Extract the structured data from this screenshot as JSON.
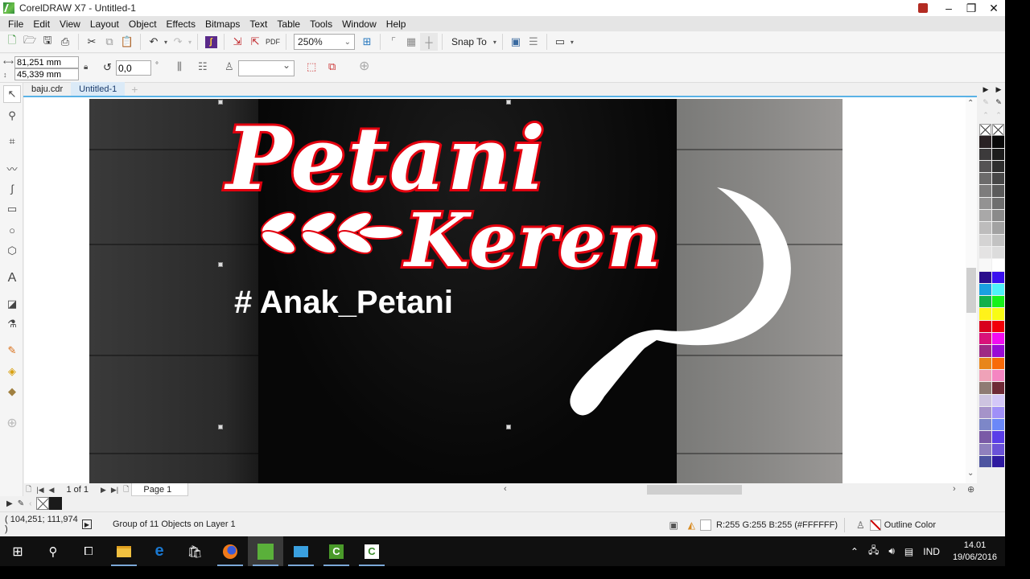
{
  "window": {
    "title": "CorelDRAW X7 - Untitled-1",
    "controls": [
      "minimize",
      "restore",
      "close"
    ]
  },
  "menu": {
    "items": [
      {
        "label": "File"
      },
      {
        "label": "Edit"
      },
      {
        "label": "View"
      },
      {
        "label": "Layout"
      },
      {
        "label": "Object"
      },
      {
        "label": "Effects"
      },
      {
        "label": "Bitmaps"
      },
      {
        "label": "Text"
      },
      {
        "label": "Table"
      },
      {
        "label": "Tools"
      },
      {
        "label": "Window"
      },
      {
        "label": "Help"
      }
    ]
  },
  "toolbar": {
    "zoom_level": "250%",
    "snap_to_label": "Snap To"
  },
  "propbar": {
    "width_value": "81,251 mm",
    "height_value": "45,339 mm",
    "rotation_value": "0,0",
    "degree_symbol": "°",
    "outline_width_value": ""
  },
  "doc_tabs": [
    {
      "label": "baju.cdr",
      "active": false
    },
    {
      "label": "Untitled-1",
      "active": true
    }
  ],
  "canvas": {
    "design_title_line1": "Petani",
    "design_title_line2": "Keren",
    "design_hashtag": "# Anak_Petani",
    "title_fill": "#ffffff",
    "title_outline": "#e3000f"
  },
  "page_nav": {
    "page_count": "1 of 1",
    "page_tab_label": "Page 1"
  },
  "palette": {
    "col1": [
      "#2a2224",
      "#3c3a3b",
      "#555354",
      "#6c6b6b",
      "#7d7c7c",
      "#939292",
      "#a9a8a8",
      "#bdbcbc",
      "#d4d3d3",
      "#e4e3e3",
      "#f8f8f8",
      "#2a0e8c",
      "#1aa0e0",
      "#12b04a",
      "#fff21a",
      "#d8001c",
      "#d8127a",
      "#9e2a84",
      "#e8861a",
      "#efa2b8",
      "#8e7b73",
      "#cdc4e0",
      "#a593c9",
      "#7d87c8",
      "#7a5aa6",
      "#8f80bd",
      "#4d54a0"
    ],
    "col2": [
      "#080808",
      "#1c1c1c",
      "#2e2e2e",
      "#474747",
      "#5b5b5b",
      "#6e6e6e",
      "#8a8a8a",
      "#a2a2a2",
      "#c2c2c2",
      "#dcdcdc",
      "#ffffff",
      "#3a10f0",
      "#4ef2fa",
      "#16f21a",
      "#f8fc14",
      "#f20008",
      "#f20cf0",
      "#9a0ad6",
      "#f86a08",
      "#f586c2",
      "#6e2a36",
      "#d4c8f8",
      "#a090f8",
      "#6a88f8",
      "#5a3ee8",
      "#6a52d8",
      "#2e1aa0"
    ]
  },
  "status": {
    "coordinates": "( 104,251; 111,974 )",
    "selection_info": "Group of 11 Objects on Layer 1",
    "fill_info": "R:255 G:255 B:255 (#FFFFFF)",
    "outline_info": "Outline Color"
  },
  "taskbar": {
    "apps": [
      {
        "name": "file-explorer",
        "open": true
      },
      {
        "name": "edge",
        "open": false
      },
      {
        "name": "store",
        "open": false
      },
      {
        "name": "firefox",
        "open": true
      },
      {
        "name": "coreldraw",
        "open": true,
        "active": true
      },
      {
        "name": "app-blue",
        "open": true
      },
      {
        "name": "camtasia-recorder",
        "open": true
      },
      {
        "name": "camtasia-studio",
        "open": true
      }
    ],
    "language": "IND",
    "time": "14.01",
    "date": "19/06/2016"
  }
}
